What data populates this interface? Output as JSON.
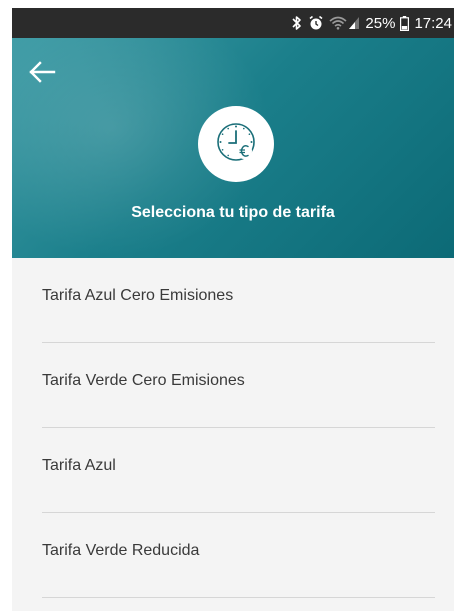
{
  "status_bar": {
    "battery_percent": "25%",
    "time": "17:24",
    "icons": [
      "bluetooth-icon",
      "alarm-icon",
      "wifi-icon",
      "signal-icon",
      "battery-icon"
    ]
  },
  "header": {
    "title": "Selecciona tu tipo de tarifa",
    "back_icon": "arrow-left-icon",
    "logo_icon": "clock-euro-icon",
    "colors": {
      "gradient_start": "#3f9ca6",
      "gradient_end": "#0c6a76",
      "logo_stroke": "#1b6f79"
    }
  },
  "tariffs": {
    "items": [
      {
        "label": "Tarifa Azul Cero Emisiones"
      },
      {
        "label": "Tarifa Verde Cero Emisiones"
      },
      {
        "label": "Tarifa Azul"
      },
      {
        "label": "Tarifa Verde Reducida"
      }
    ]
  }
}
